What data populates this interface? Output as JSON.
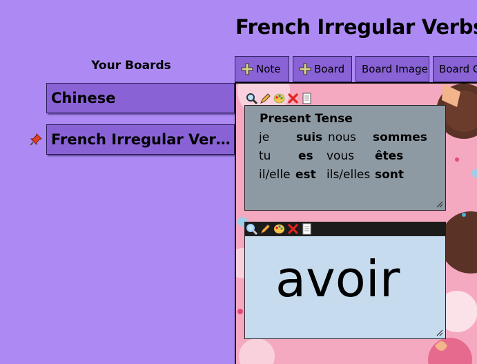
{
  "board": {
    "title": "French Irregular Verbs"
  },
  "sidebar": {
    "heading": "Your Boards",
    "items": [
      {
        "label": "Chinese",
        "pinned": false
      },
      {
        "label": "French Irregular Verbs",
        "pinned": true
      }
    ]
  },
  "toolbar": {
    "note_label": "Note",
    "board_label": "Board",
    "board_image_label": "Board Image",
    "board_color_label": "Board Color"
  },
  "notes": [
    {
      "title": "Present Tense",
      "rows": [
        {
          "p1": "je",
          "v1": "suis",
          "p2": "nous",
          "v2": "sommes"
        },
        {
          "p1": "tu",
          "v1": "es",
          "p2": "vous",
          "v2": "êtes"
        },
        {
          "p1": "il/elle",
          "v1": "est",
          "p2": "ils/elles",
          "v2": "sont"
        }
      ],
      "color": "#8e9aa3"
    },
    {
      "text": "avoir",
      "color": "#c6dbed"
    }
  ],
  "colors": {
    "background": "#ad8af3",
    "board_item": "#8962d6"
  },
  "icons": [
    "pin-icon",
    "plus-icon",
    "magnifier-icon",
    "pencil-icon",
    "palette-icon",
    "close-icon",
    "notepad-icon",
    "resize-handle-icon"
  ]
}
